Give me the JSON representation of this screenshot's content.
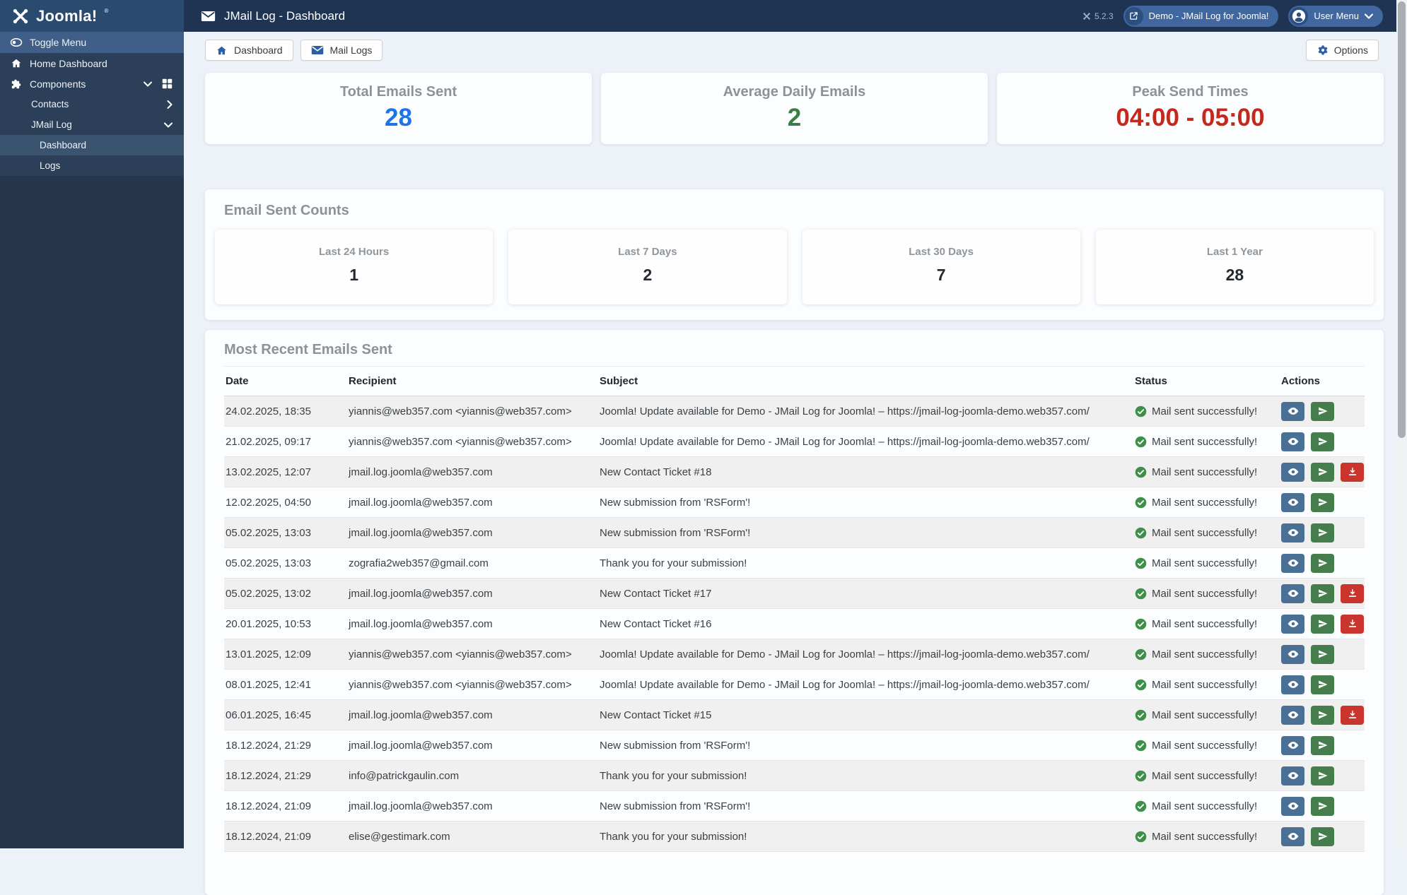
{
  "header": {
    "title": "JMail Log - Dashboard",
    "version": "5.2.3",
    "demo_button": "Demo - JMail Log for Joomla!",
    "user_menu": "User Menu"
  },
  "sidebar": {
    "logo_text": "Joomla!",
    "items": [
      {
        "label": "Toggle Menu"
      },
      {
        "label": "Home Dashboard"
      },
      {
        "label": "Components"
      },
      {
        "label": "Contacts"
      },
      {
        "label": "JMail Log"
      },
      {
        "label": "Dashboard"
      },
      {
        "label": "Logs"
      }
    ]
  },
  "toolbar": {
    "dashboard_label": "Dashboard",
    "mail_logs_label": "Mail Logs",
    "options_label": "Options"
  },
  "stats": [
    {
      "label": "Total Emails Sent",
      "value": "28",
      "color": "#1d73e8"
    },
    {
      "label": "Average Daily Emails",
      "value": "2",
      "color": "#3c7d44"
    },
    {
      "label": "Peak Send Times",
      "value": "04:00 - 05:00",
      "color": "#c5281c"
    }
  ],
  "email_counts": {
    "heading": "Email Sent Counts",
    "cards": [
      {
        "label": "Last 24 Hours",
        "value": "1"
      },
      {
        "label": "Last 7 Days",
        "value": "2"
      },
      {
        "label": "Last 30 Days",
        "value": "7"
      },
      {
        "label": "Last 1 Year",
        "value": "28"
      }
    ]
  },
  "recent": {
    "heading": "Most Recent Emails Sent",
    "columns": {
      "date": "Date",
      "recipient": "Recipient",
      "subject": "Subject",
      "status": "Status",
      "actions": "Actions"
    },
    "status_text": "Mail sent successfully!",
    "rows": [
      {
        "date": "24.02.2025, 18:35",
        "recipient": "yiannis@web357.com <yiannis@web357.com>",
        "subject": "Joomla! Update available for Demo - JMail Log for Joomla! – https://jmail-log-joomla-demo.web357.com/",
        "actions": [
          "view",
          "resend"
        ]
      },
      {
        "date": "21.02.2025, 09:17",
        "recipient": "yiannis@web357.com <yiannis@web357.com>",
        "subject": "Joomla! Update available for Demo - JMail Log for Joomla! – https://jmail-log-joomla-demo.web357.com/",
        "actions": [
          "view",
          "resend"
        ]
      },
      {
        "date": "13.02.2025, 12:07",
        "recipient": "jmail.log.joomla@web357.com",
        "subject": "New Contact Ticket #18",
        "actions": [
          "view",
          "resend",
          "download"
        ]
      },
      {
        "date": "12.02.2025, 04:50",
        "recipient": "jmail.log.joomla@web357.com",
        "subject": "New submission from 'RSForm'!",
        "actions": [
          "view",
          "resend"
        ]
      },
      {
        "date": "05.02.2025, 13:03",
        "recipient": "jmail.log.joomla@web357.com",
        "subject": "New submission from 'RSForm'!",
        "actions": [
          "view",
          "resend"
        ]
      },
      {
        "date": "05.02.2025, 13:03",
        "recipient": "zografia2web357@gmail.com",
        "subject": "Thank you for your submission!",
        "actions": [
          "view",
          "resend"
        ]
      },
      {
        "date": "05.02.2025, 13:02",
        "recipient": "jmail.log.joomla@web357.com",
        "subject": "New Contact Ticket #17",
        "actions": [
          "view",
          "resend",
          "download"
        ]
      },
      {
        "date": "20.01.2025, 10:53",
        "recipient": "jmail.log.joomla@web357.com",
        "subject": "New Contact Ticket #16",
        "actions": [
          "view",
          "resend",
          "download"
        ]
      },
      {
        "date": "13.01.2025, 12:09",
        "recipient": "yiannis@web357.com <yiannis@web357.com>",
        "subject": "Joomla! Update available for Demo - JMail Log for Joomla! – https://jmail-log-joomla-demo.web357.com/",
        "actions": [
          "view",
          "resend"
        ]
      },
      {
        "date": "08.01.2025, 12:41",
        "recipient": "yiannis@web357.com <yiannis@web357.com>",
        "subject": "Joomla! Update available for Demo - JMail Log for Joomla! – https://jmail-log-joomla-demo.web357.com/",
        "actions": [
          "view",
          "resend"
        ]
      },
      {
        "date": "06.01.2025, 16:45",
        "recipient": "jmail.log.joomla@web357.com",
        "subject": "New Contact Ticket #15",
        "actions": [
          "view",
          "resend",
          "download"
        ]
      },
      {
        "date": "18.12.2024, 21:29",
        "recipient": "jmail.log.joomla@web357.com",
        "subject": "New submission from 'RSForm'!",
        "actions": [
          "view",
          "resend"
        ]
      },
      {
        "date": "18.12.2024, 21:29",
        "recipient": "info@patrickgaulin.com",
        "subject": "Thank you for your submission!",
        "actions": [
          "view",
          "resend"
        ]
      },
      {
        "date": "18.12.2024, 21:09",
        "recipient": "jmail.log.joomla@web357.com",
        "subject": "New submission from 'RSForm'!",
        "actions": [
          "view",
          "resend"
        ]
      },
      {
        "date": "18.12.2024, 21:09",
        "recipient": "elise@gestimark.com",
        "subject": "Thank you for your submission!",
        "actions": [
          "view",
          "resend"
        ]
      }
    ]
  },
  "colors": {
    "view": "#4a7096",
    "resend": "#457d4d",
    "download": "#c9342c",
    "status": "#3f8e4a",
    "header_bg": "#1f3452",
    "sidebar_bg": "#25364c"
  }
}
